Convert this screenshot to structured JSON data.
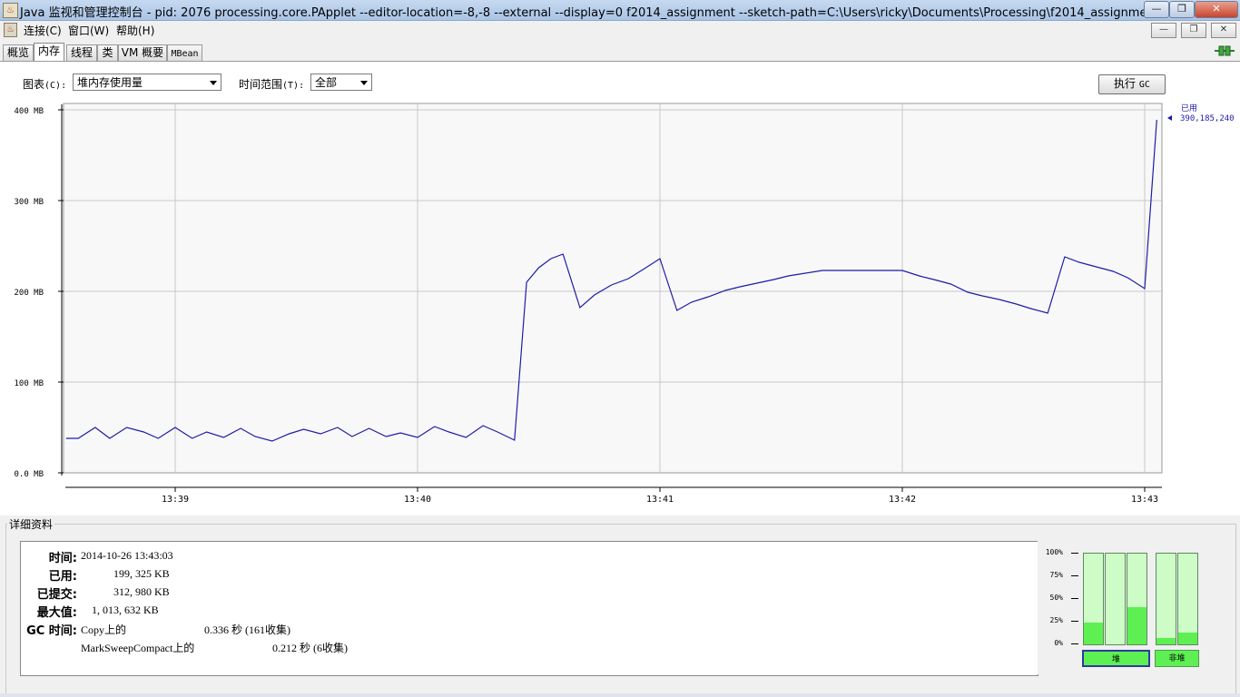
{
  "window": {
    "title": "Java 监视和管理控制台 - pid: 2076 processing.core.PApplet --editor-location=-8,-8 --external --display=0 f2014_assignment --sketch-path=C:\\Users\\ricky\\Documents\\Processing\\f2014_assignment",
    "app_icon": "java-cup-icon",
    "controls": {
      "minimize": "—",
      "restore": "❐",
      "close": "✕"
    }
  },
  "menu": {
    "items": [
      "连接(C)",
      "窗口(W)",
      "帮助(H)"
    ],
    "mdi_controls": {
      "minimize": "—",
      "restore": "❐",
      "close": "✕"
    }
  },
  "tabs": [
    {
      "label": "概览"
    },
    {
      "label": "内存",
      "active": true
    },
    {
      "label": "线程"
    },
    {
      "label": "类"
    },
    {
      "label": "VM 概要"
    },
    {
      "label": "MBean"
    }
  ],
  "connection_icon": "connected-plug-icon",
  "controls": {
    "chart_label_cn": "图表",
    "chart_label_key": "(C):",
    "chart_select": "堆内存使用量",
    "range_label_cn": "时间范围",
    "range_label_key": "(T):",
    "range_select": "全部",
    "gc_button_cn": "执行",
    "gc_button_en": "GC"
  },
  "chart_data": {
    "type": "line",
    "y_unit": "MB",
    "ylim": [
      0,
      400
    ],
    "yticks": [
      "400 MB",
      "300 MB",
      "200 MB",
      "100 MB",
      "0.0 MB"
    ],
    "ytick_values": [
      400,
      300,
      200,
      100,
      0
    ],
    "xticks": [
      "13:39",
      "13:40",
      "13:41",
      "13:42",
      "13:43"
    ],
    "xtick_minutes": [
      0,
      1,
      2,
      3,
      4
    ],
    "xlim_minutes": [
      -0.45,
      4.05
    ],
    "grid": true,
    "series": [
      {
        "name": "已用",
        "color": "#1c1ca8",
        "current_value": "390,185,240",
        "x_minutes": [
          -0.45,
          -0.4,
          -0.33,
          -0.27,
          -0.2,
          -0.13,
          -0.07,
          0.0,
          0.07,
          0.13,
          0.2,
          0.27,
          0.33,
          0.4,
          0.47,
          0.53,
          0.6,
          0.67,
          0.73,
          0.8,
          0.87,
          0.93,
          1.0,
          1.07,
          1.13,
          1.2,
          1.27,
          1.33,
          1.4,
          1.45,
          1.5,
          1.55,
          1.6,
          1.67,
          1.73,
          1.8,
          1.87,
          1.93,
          2.0,
          2.07,
          2.13,
          2.2,
          2.27,
          2.33,
          2.4,
          2.47,
          2.53,
          2.6,
          2.67,
          2.73,
          2.8,
          2.87,
          2.93,
          3.0,
          3.07,
          3.13,
          3.2,
          3.27,
          3.33,
          3.4,
          3.47,
          3.53,
          3.6,
          3.67,
          3.73,
          3.8,
          3.87,
          3.93,
          4.0,
          4.05
        ],
        "values": [
          38,
          38,
          50,
          38,
          50,
          45,
          38,
          50,
          38,
          45,
          39,
          49,
          40,
          35,
          43,
          48,
          43,
          50,
          40,
          49,
          40,
          44,
          39,
          51,
          45,
          39,
          52,
          45,
          36,
          210,
          226,
          236,
          241,
          182,
          196,
          207,
          214,
          224,
          236,
          179,
          188,
          194,
          201,
          205,
          209,
          213,
          217,
          220,
          223,
          223,
          223,
          223,
          223,
          223,
          217,
          213,
          208,
          199,
          195,
          191,
          186,
          181,
          176,
          238,
          232,
          227,
          222,
          215,
          203,
          389
        ]
      }
    ]
  },
  "details": {
    "section_title": "详细资料",
    "time_label": "时间:",
    "time_value": "2014-10-26 13:43:03",
    "used_label": "已用:",
    "used_value": "199, 325 KB",
    "committed_label": "已提交:",
    "committed_value": "312, 980 KB",
    "max_label": "最大值:",
    "max_value": "1, 013, 632 KB",
    "gc_label": "GC 时间:",
    "gc1_name": "Copy上的",
    "gc1_value": "0.336 秒 (161收集)",
    "gc2_name": "MarkSweepCompact上的",
    "gc2_value": "0.212 秒 (6收集)"
  },
  "pools": {
    "ticks": [
      "100%",
      "75%",
      "50%",
      "25%",
      "0%"
    ],
    "heap_bars": [
      0.24,
      0.0,
      0.41
    ],
    "nonheap_bars": [
      0.07,
      0.13
    ],
    "heap_label": "堆",
    "nonheap_label": "非堆",
    "bar_color": "#5ef053",
    "bar_bg_color": "#cdfcc7"
  }
}
